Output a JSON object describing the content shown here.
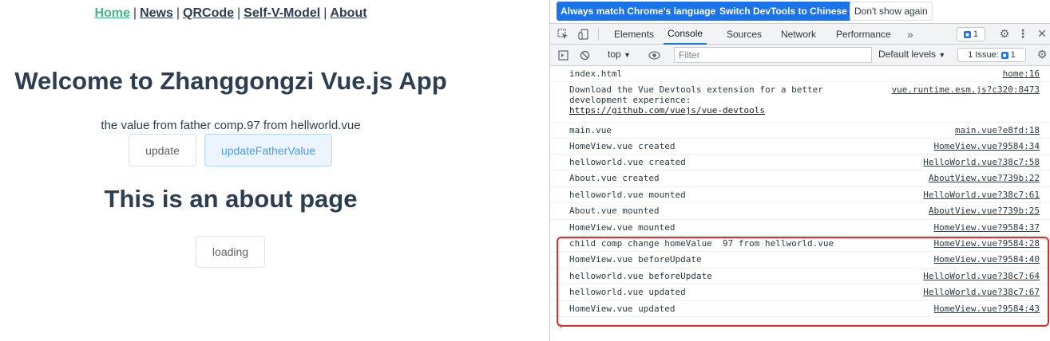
{
  "app": {
    "nav": [
      {
        "label": "Home",
        "active": true
      },
      {
        "label": "News"
      },
      {
        "label": "QRCode"
      },
      {
        "label": "Self-V-Model"
      },
      {
        "label": "About"
      }
    ],
    "nav_separator": "|",
    "title": "Welcome to Zhanggongzi Vue.js App",
    "message": "the value from father comp.97 from hellworld.vue",
    "update_label": "update",
    "update_father_label": "updateFatherValue",
    "about_title": "This is an about page",
    "loading_label": "loading"
  },
  "devtools": {
    "infobar": {
      "match_language": "Always match Chrome's language",
      "switch_chinese": "Switch DevTools to Chinese",
      "dont_show": "Don't show again"
    },
    "tabs": [
      "Elements",
      "Console",
      "Sources",
      "Network",
      "Performance"
    ],
    "active_tab": "Console",
    "more_tabs": "»",
    "message_badge": "1",
    "filterbar": {
      "context": "top",
      "filter_placeholder": "Filter",
      "levels": "Default levels",
      "issues_label": "1 Issue:",
      "issues_count": "1"
    },
    "console_rows": [
      {
        "text": "index.html",
        "source": "home:16"
      },
      {
        "text": "Download the Vue Devtools extension for a better\ndevelopment experience:",
        "link": "https://github.com/vuejs/vue-devtools",
        "source": "vue.runtime.esm.js?c320:8473"
      },
      {
        "text": "main.vue",
        "source": "main.vue?e8fd:18"
      },
      {
        "text": "HomeView.vue created",
        "source": "HomeView.vue?9584:34"
      },
      {
        "text": "helloworld.vue created",
        "source": "HelloWorld.vue?38c7:58"
      },
      {
        "text": "About.vue created",
        "source": "AboutView.vue?739b:22"
      },
      {
        "text": "helloworld.vue mounted",
        "source": "HelloWorld.vue?38c7:61"
      },
      {
        "text": "About.vue mounted",
        "source": "AboutView.vue?739b:25"
      },
      {
        "text": "HomeView.vue mounted",
        "source": "HomeView.vue?9584:37"
      },
      {
        "text": "child comp change homeValue  97 from hellworld.vue",
        "source": "HomeView.vue?9584:28"
      },
      {
        "text": "HomeView.vue beforeUpdate",
        "source": "HomeView.vue?9584:40"
      },
      {
        "text": "helloworld.vue beforeUpdate",
        "source": "HelloWorld.vue?38c7:64"
      },
      {
        "text": "helloworld.vue updated",
        "source": "HelloWorld.vue?38c7:67"
      },
      {
        "text": "HomeView.vue updated",
        "source": "HomeView.vue?9584:43"
      }
    ],
    "prompt": "›"
  },
  "colors": {
    "vue_green": "#42b983",
    "text_dark": "#2c3e50",
    "chrome_blue": "#1a73e8",
    "highlight_red": "#e8281e"
  }
}
